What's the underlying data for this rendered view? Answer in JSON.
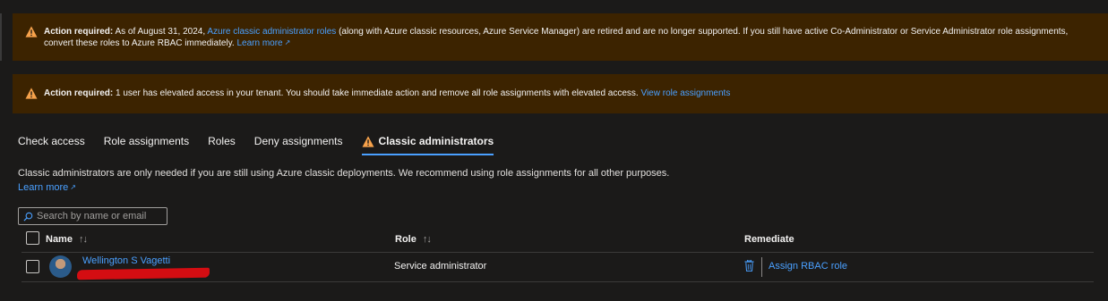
{
  "banners": [
    {
      "icon": "warning-icon",
      "bold": "Action required:",
      "text_before": "As of August 31, 2024,",
      "link1": "Azure classic administrator roles",
      "text_after": "(along with Azure classic resources, Azure Service Manager) are retired and are no longer supported. If you still have active Co-Administrator or Service Administrator role assignments, convert these roles to Azure RBAC immediately.",
      "link2": "Learn more"
    },
    {
      "icon": "warning-icon",
      "bold": "Action required:",
      "text": "1 user has elevated access in your tenant. You should take immediate action and remove all role assignments with elevated access.",
      "link": "View role assignments"
    }
  ],
  "tabs": [
    {
      "label": "Check access"
    },
    {
      "label": "Role assignments"
    },
    {
      "label": "Roles"
    },
    {
      "label": "Deny assignments"
    },
    {
      "label": "Classic administrators",
      "active": true,
      "icon": "warning-icon"
    }
  ],
  "description": {
    "text": "Classic administrators are only needed if you are still using Azure classic deployments. We recommend using role assignments for all other purposes.",
    "link": "Learn more"
  },
  "search": {
    "placeholder": "Search by name or email",
    "value": ""
  },
  "table": {
    "columns": [
      {
        "label": "Name",
        "sortable": true
      },
      {
        "label": "Role",
        "sortable": true
      },
      {
        "label": "Remediate",
        "sortable": false
      }
    ],
    "sort_icon": "↑↓",
    "rows": [
      {
        "name": "Wellington S Vagetti",
        "email_redacted": true,
        "role": "Service administrator",
        "remediate_action": "Assign RBAC role"
      }
    ]
  },
  "colors": {
    "background": "#1b1a19",
    "banner": "#3c2300",
    "warning": "#f7a24b",
    "link": "#4aa0ff",
    "redaction": "#d40d12"
  }
}
